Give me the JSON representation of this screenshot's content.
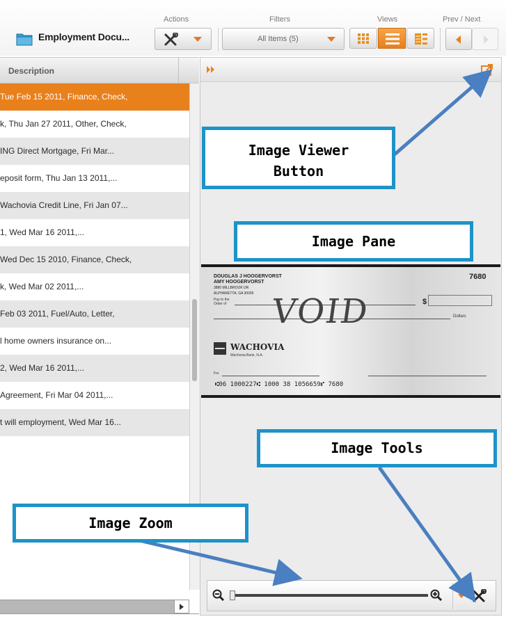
{
  "toolbar": {
    "title": "Employment Docu...",
    "actions_label": "Actions",
    "filters_label": "Filters",
    "filters_value": "All Items (5)",
    "views_label": "Views",
    "prevnext_label": "Prev / Next",
    "icons": [
      "folder-icon",
      "tools-icon",
      "grid-view-icon",
      "list-view-icon",
      "detail-view-icon",
      "prev-icon",
      "next-icon"
    ]
  },
  "list": {
    "header": "Description",
    "rows": [
      "Tue Feb 15 2011, Finance, Check,",
      "k, Thu Jan 27 2011, Other, Check,",
      "ING Direct Mortgage, Fri Mar...",
      "eposit form, Thu Jan 13 2011,...",
      "Wachovia Credit Line, Fri Jan 07...",
      "1, Wed Mar 16 2011,...",
      "Wed Dec 15 2010, Finance, Check,",
      "k, Wed Mar 02 2011,...",
      "Feb 03 2011, Fuel/Auto, Letter,",
      "l home owners insurance on...",
      "2, Wed Mar 16 2011,...",
      "Agreement, Fri Mar 04 2011,...",
      "t will employment, Wed Mar 16..."
    ],
    "selected_index": 0
  },
  "check": {
    "payer_line1": "DOUGLAS J HOOGERVORST",
    "payer_line2": "AMY HOOGERVORST",
    "payer_line3": "3880 MILLBROOK DR",
    "payer_line4": "ALPHARETTA, GA 30005",
    "number": "7680",
    "void_text": "VOID",
    "bank": "WACHOVIA",
    "bank_sub": "Wachovia Bank, N.A.",
    "micr": "⑆06 1000227⑆ 1000 38 1056659⑈ 7680",
    "pay_to": "Pay to the Order of",
    "dollars": "Dollars",
    "memo": "For"
  },
  "callouts": {
    "image_viewer_button": [
      "Image Viewer",
      "Button"
    ],
    "image_pane": "Image Pane",
    "image_tools": "Image Tools",
    "image_zoom": "Image Zoom"
  },
  "colors": {
    "accent": "#e8801c",
    "callout_border": "#1d93c9",
    "arrow": "#4a7fc1"
  }
}
